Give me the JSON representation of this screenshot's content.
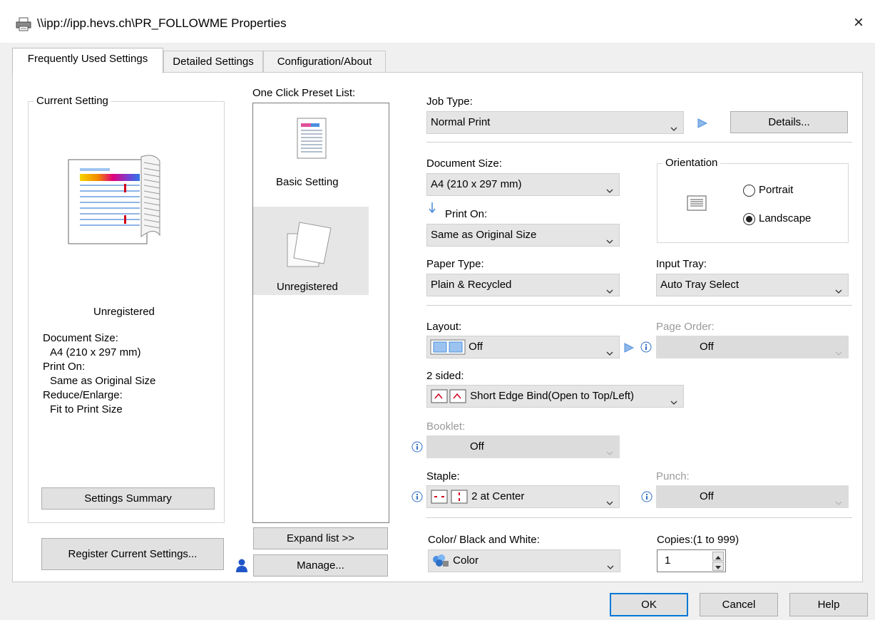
{
  "window": {
    "title": "\\\\ipp://ipp.hevs.ch\\PR_FOLLOWME Properties",
    "close": "×"
  },
  "tabs": [
    {
      "label": "Frequently Used Settings"
    },
    {
      "label": "Detailed Settings"
    },
    {
      "label": "Configuration/About"
    }
  ],
  "current_setting": {
    "legend": "Current Setting",
    "preset_name": "Unregistered",
    "lines": [
      "Document Size:",
      "A4 (210 x 297 mm)",
      "Print On:",
      "Same as Original Size",
      "Reduce/Enlarge:",
      "Fit to Print Size"
    ],
    "summary_button": "Settings Summary",
    "register_button": "Register Current Settings..."
  },
  "preset_list": {
    "label": "One Click Preset List:",
    "items": [
      {
        "label": "Basic Setting"
      },
      {
        "label": "Unregistered"
      }
    ],
    "expand_button": "Expand list >>",
    "manage_button": "Manage..."
  },
  "settings": {
    "job_type": {
      "label": "Job Type:",
      "value": "Normal Print",
      "details_button": "Details..."
    },
    "document_size": {
      "label": "Document Size:",
      "value": "A4 (210 x 297 mm)"
    },
    "print_on": {
      "label": "Print On:",
      "value": "Same as Original Size"
    },
    "orientation": {
      "legend": "Orientation",
      "portrait": "Portrait",
      "landscape": "Landscape",
      "selected": "Landscape"
    },
    "paper_type": {
      "label": "Paper Type:",
      "value": "Plain & Recycled"
    },
    "input_tray": {
      "label": "Input Tray:",
      "value": "Auto Tray Select"
    },
    "layout": {
      "label": "Layout:",
      "value": "Off"
    },
    "page_order": {
      "label": "Page Order:",
      "value": "Off"
    },
    "two_sided": {
      "label": "2 sided:",
      "value": "Short Edge Bind(Open to Top/Left)"
    },
    "booklet": {
      "label": "Booklet:",
      "value": "Off"
    },
    "staple": {
      "label": "Staple:",
      "value": "2 at Center"
    },
    "punch": {
      "label": "Punch:",
      "value": "Off"
    },
    "color": {
      "label": "Color/ Black and White:",
      "value": "Color"
    },
    "copies": {
      "label": "Copies:(1 to 999)",
      "value": "1"
    }
  },
  "footer": {
    "ok": "OK",
    "cancel": "Cancel",
    "help": "Help"
  },
  "colors": {
    "accent": "#0078d7",
    "panel_bg": "#ffffff",
    "dialog_bg": "#f0f0f0",
    "combo_bg": "#e5e5e5"
  }
}
